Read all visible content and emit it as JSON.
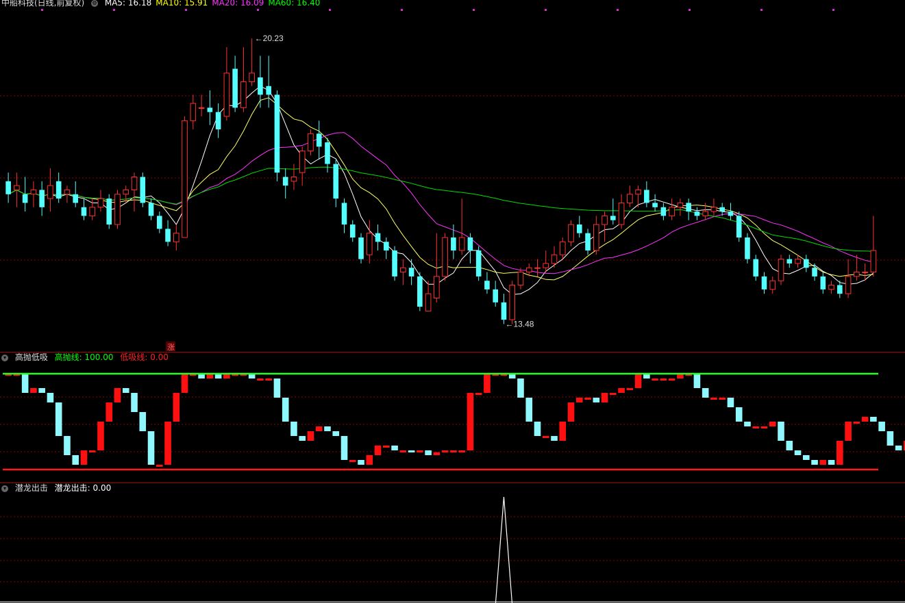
{
  "main": {
    "title": "中船科技(日线,前复权)",
    "ma": [
      {
        "label": "MA5: 16.18",
        "color": "#ffffff",
        "key": "ma5"
      },
      {
        "label": "MA10: 15.91",
        "color": "#ffff00",
        "key": "ma10"
      },
      {
        "label": "MA20: 16.09",
        "color": "#ff33ff",
        "key": "ma20"
      },
      {
        "label": "MA60: 16.40",
        "color": "#00ff00",
        "key": "ma60"
      }
    ],
    "high_label": "20.23",
    "low_label": "13.48",
    "marker": "涨"
  },
  "panel2": {
    "title": "高抛低吸",
    "items": [
      {
        "label": "高抛线: 100.00",
        "color": "#00ff00"
      },
      {
        "label": "低吸线: 0.00",
        "color": "#ff2222"
      }
    ]
  },
  "panel3": {
    "title": "潜龙出击",
    "items": [
      {
        "label": "潜龙出击: 0.00",
        "color": "#ffffff"
      }
    ]
  },
  "colors": {
    "up": "#ff3030",
    "down": "#54ffff",
    "grid": "#8b0000",
    "bg": "#000000"
  },
  "chart_data": [
    {
      "type": "candlestick",
      "ylim": [
        13.0,
        20.8
      ],
      "candles": [
        [
          16.8,
          16.5,
          17.0,
          16.3
        ],
        [
          16.6,
          16.7,
          17.0,
          16.2
        ],
        [
          16.5,
          16.3,
          16.9,
          16.1
        ],
        [
          16.5,
          16.6,
          16.8,
          16.2
        ],
        [
          16.6,
          16.2,
          16.8,
          16.0
        ],
        [
          16.4,
          16.7,
          17.1,
          16.1
        ],
        [
          16.8,
          16.4,
          17.0,
          16.3
        ],
        [
          16.5,
          16.6,
          16.7,
          16.3
        ],
        [
          16.5,
          16.3,
          16.8,
          16.2
        ],
        [
          16.2,
          16.0,
          16.4,
          15.9
        ],
        [
          16.0,
          16.2,
          16.4,
          15.9
        ],
        [
          16.2,
          16.4,
          16.6,
          16.1
        ],
        [
          16.4,
          15.8,
          16.5,
          15.7
        ],
        [
          15.8,
          16.5,
          16.6,
          15.7
        ],
        [
          16.5,
          16.6,
          16.7,
          16.3
        ],
        [
          16.6,
          16.9,
          17.0,
          16.1
        ],
        [
          16.9,
          16.3,
          17.0,
          16.2
        ],
        [
          16.3,
          16.0,
          16.4,
          15.9
        ],
        [
          16.0,
          15.7,
          16.1,
          15.6
        ],
        [
          15.7,
          15.4,
          15.9,
          15.3
        ],
        [
          15.4,
          15.6,
          15.8,
          15.2
        ],
        [
          15.5,
          18.2,
          18.3,
          15.5
        ],
        [
          18.2,
          18.6,
          18.8,
          18.0
        ],
        [
          18.5,
          18.5,
          18.8,
          18.3
        ],
        [
          18.5,
          18.4,
          18.9,
          18.1
        ],
        [
          18.4,
          18.0,
          18.6,
          17.8
        ],
        [
          18.3,
          19.3,
          19.9,
          18.2
        ],
        [
          19.4,
          18.5,
          19.7,
          18.4
        ],
        [
          18.5,
          19.1,
          19.9,
          18.4
        ],
        [
          19.1,
          19.3,
          20.1,
          19.0
        ],
        [
          19.2,
          18.8,
          19.7,
          18.5
        ],
        [
          19.0,
          18.8,
          19.7,
          18.5
        ],
        [
          18.8,
          17.0,
          18.9,
          16.8
        ],
        [
          16.9,
          16.7,
          17.1,
          16.4
        ],
        [
          16.8,
          16.9,
          17.2,
          16.6
        ],
        [
          17.0,
          17.5,
          17.6,
          16.7
        ],
        [
          17.5,
          17.9,
          18.0,
          17.4
        ],
        [
          17.9,
          17.6,
          18.2,
          17.3
        ],
        [
          17.7,
          17.2,
          17.8,
          17.0
        ],
        [
          17.2,
          16.4,
          17.3,
          16.2
        ],
        [
          16.3,
          15.8,
          16.4,
          15.6
        ],
        [
          15.8,
          15.5,
          15.9,
          15.4
        ],
        [
          15.5,
          15.0,
          15.6,
          14.9
        ],
        [
          15.1,
          15.6,
          15.9,
          14.9
        ],
        [
          15.6,
          15.4,
          15.8,
          15.2
        ],
        [
          15.4,
          15.2,
          15.5,
          15.0
        ],
        [
          15.2,
          14.6,
          15.3,
          14.5
        ],
        [
          14.7,
          14.8,
          15.0,
          14.4
        ],
        [
          14.8,
          14.6,
          15.0,
          14.4
        ],
        [
          14.6,
          13.9,
          14.7,
          13.8
        ],
        [
          13.8,
          14.2,
          14.5,
          13.8
        ],
        [
          14.1,
          14.6,
          15.6,
          14.0
        ],
        [
          14.6,
          15.5,
          15.6,
          14.5
        ],
        [
          15.5,
          15.2,
          15.8,
          15.0
        ],
        [
          15.2,
          15.5,
          16.4,
          15.1
        ],
        [
          15.5,
          15.2,
          15.6,
          14.9
        ],
        [
          15.2,
          14.6,
          15.3,
          14.5
        ],
        [
          14.5,
          14.3,
          14.7,
          14.2
        ],
        [
          14.3,
          14.0,
          14.5,
          13.9
        ],
        [
          14.0,
          13.6,
          14.2,
          13.5
        ],
        [
          13.6,
          14.4,
          14.5,
          13.5
        ],
        [
          14.4,
          14.7,
          14.8,
          14.3
        ],
        [
          14.7,
          14.8,
          14.9,
          14.6
        ],
        [
          14.8,
          14.8,
          15.0,
          14.6
        ],
        [
          14.8,
          14.9,
          15.2,
          14.7
        ],
        [
          14.9,
          15.1,
          15.3,
          14.8
        ],
        [
          15.1,
          15.4,
          15.5,
          15.0
        ],
        [
          15.4,
          15.8,
          15.9,
          15.3
        ],
        [
          15.8,
          15.6,
          16.0,
          15.5
        ],
        [
          15.6,
          15.2,
          15.7,
          15.1
        ],
        [
          15.2,
          15.8,
          16.0,
          15.1
        ],
        [
          15.8,
          16.0,
          16.1,
          15.4
        ],
        [
          16.0,
          15.9,
          16.4,
          15.8
        ],
        [
          15.8,
          16.3,
          16.5,
          15.7
        ],
        [
          16.3,
          16.5,
          16.7,
          16.2
        ],
        [
          16.5,
          16.6,
          16.7,
          16.2
        ],
        [
          16.6,
          16.3,
          16.8,
          16.2
        ],
        [
          16.3,
          16.2,
          16.5,
          16.1
        ],
        [
          16.2,
          16.0,
          16.3,
          15.9
        ],
        [
          16.0,
          16.2,
          16.4,
          15.9
        ],
        [
          16.2,
          16.3,
          16.4,
          16.0
        ],
        [
          16.3,
          16.1,
          16.4,
          15.9
        ],
        [
          16.1,
          16.0,
          16.2,
          15.9
        ],
        [
          16.0,
          16.1,
          16.3,
          15.9
        ],
        [
          16.1,
          16.2,
          16.4,
          16.0
        ],
        [
          16.2,
          16.1,
          16.3,
          16.0
        ],
        [
          16.1,
          16.0,
          16.3,
          15.9
        ],
        [
          16.0,
          15.5,
          16.1,
          15.4
        ],
        [
          15.5,
          15.0,
          15.6,
          14.9
        ],
        [
          15.0,
          14.6,
          15.1,
          14.5
        ],
        [
          14.6,
          14.3,
          14.7,
          14.2
        ],
        [
          14.3,
          14.5,
          14.6,
          14.2
        ],
        [
          14.5,
          15.0,
          15.1,
          14.4
        ],
        [
          15.0,
          14.9,
          15.1,
          14.8
        ],
        [
          14.9,
          15.0,
          15.1,
          14.8
        ],
        [
          15.0,
          14.8,
          15.1,
          14.7
        ],
        [
          14.8,
          14.6,
          14.9,
          14.5
        ],
        [
          14.6,
          14.3,
          14.7,
          14.2
        ],
        [
          14.3,
          14.4,
          14.5,
          14.2
        ],
        [
          14.4,
          14.2,
          14.5,
          14.1
        ],
        [
          14.2,
          14.6,
          15.0,
          14.1
        ],
        [
          14.6,
          14.7,
          15.1,
          14.5
        ],
        [
          14.7,
          14.7,
          14.9,
          14.5
        ],
        [
          14.7,
          15.2,
          16.0,
          14.6
        ]
      ]
    },
    {
      "type": "bar",
      "ylim": [
        -10,
        110
      ],
      "lines": {
        "高抛线": 100,
        "低吸线": 0
      },
      "values": [
        100,
        100,
        80,
        85,
        80,
        70,
        35,
        15,
        5,
        20,
        20,
        50,
        70,
        85,
        80,
        60,
        40,
        5,
        5,
        50,
        80,
        100,
        100,
        95,
        100,
        95,
        100,
        100,
        100,
        95,
        95,
        95,
        75,
        50,
        35,
        30,
        40,
        45,
        40,
        35,
        10,
        10,
        5,
        15,
        25,
        25,
        20,
        20,
        18,
        20,
        15,
        18,
        20,
        20,
        20,
        80,
        80,
        100,
        100,
        100,
        95,
        75,
        50,
        35,
        35,
        30,
        50,
        70,
        75,
        75,
        70,
        80,
        80,
        85,
        85,
        100,
        95,
        95,
        95,
        95,
        100,
        100,
        85,
        75,
        75,
        75,
        65,
        50,
        45,
        45,
        45,
        50,
        30,
        20,
        15,
        10,
        5,
        10,
        5,
        30,
        50,
        50,
        55,
        50,
        40,
        25,
        20,
        30,
        35,
        60,
        60
      ],
      "spike": {
        "series": "潜龙出击",
        "value": 100
      }
    }
  ]
}
